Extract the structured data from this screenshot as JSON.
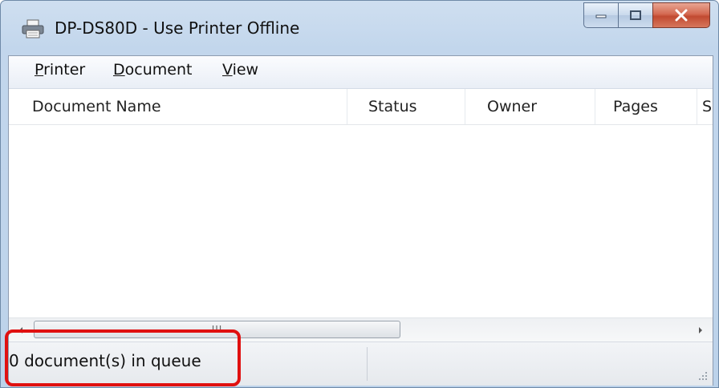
{
  "window": {
    "title": "DP-DS80D  -  Use Printer Offline",
    "icon": "printer-icon"
  },
  "caption_buttons": [
    "minimize-icon",
    "maximize-icon",
    "close-icon"
  ],
  "menu": {
    "printer": {
      "first": "P",
      "rest": "rinter"
    },
    "document": {
      "first": "D",
      "rest": "ocument"
    },
    "view": {
      "first": "V",
      "rest": "iew"
    }
  },
  "columns": [
    "Document Name",
    "Status",
    "Owner",
    "Pages",
    "S"
  ],
  "scrollbar": {
    "thumb_grip": "III"
  },
  "status": {
    "text": "0 document(s) in queue"
  },
  "colors": {
    "highlight": "#e01010",
    "close_button": "#c14a31"
  }
}
